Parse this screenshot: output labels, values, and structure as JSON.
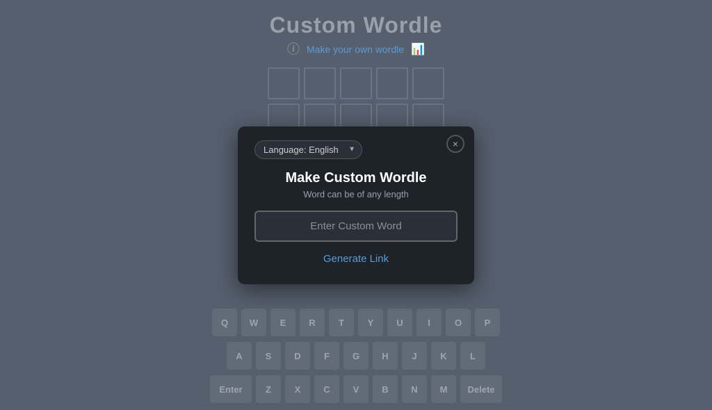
{
  "header": {
    "title": "Custom Wordle",
    "subtitle_link": "Make your own wordle"
  },
  "grid": {
    "rows": 4,
    "cols": 5
  },
  "keyboard": {
    "row1": [
      "Q",
      "W",
      "E",
      "R",
      "T",
      "Y",
      "U",
      "I",
      "O",
      "P"
    ],
    "row2": [
      "A",
      "S",
      "D",
      "F",
      "G",
      "H",
      "J",
      "K",
      "L"
    ],
    "row3": [
      "Enter",
      "Z",
      "X",
      "C",
      "V",
      "B",
      "N",
      "M",
      "Delete"
    ]
  },
  "modal": {
    "language_label": "Language: English",
    "title": "Make Custom Wordle",
    "subtitle": "Word can be of any length",
    "input_placeholder": "Enter Custom Word",
    "generate_link_label": "Generate Link",
    "close_label": "×"
  },
  "colors": {
    "accent_blue": "#5b9bd5",
    "background": "#565f6e",
    "modal_bg": "#1e2229",
    "grid_border": "#808896",
    "key_bg": "#6b7480"
  }
}
